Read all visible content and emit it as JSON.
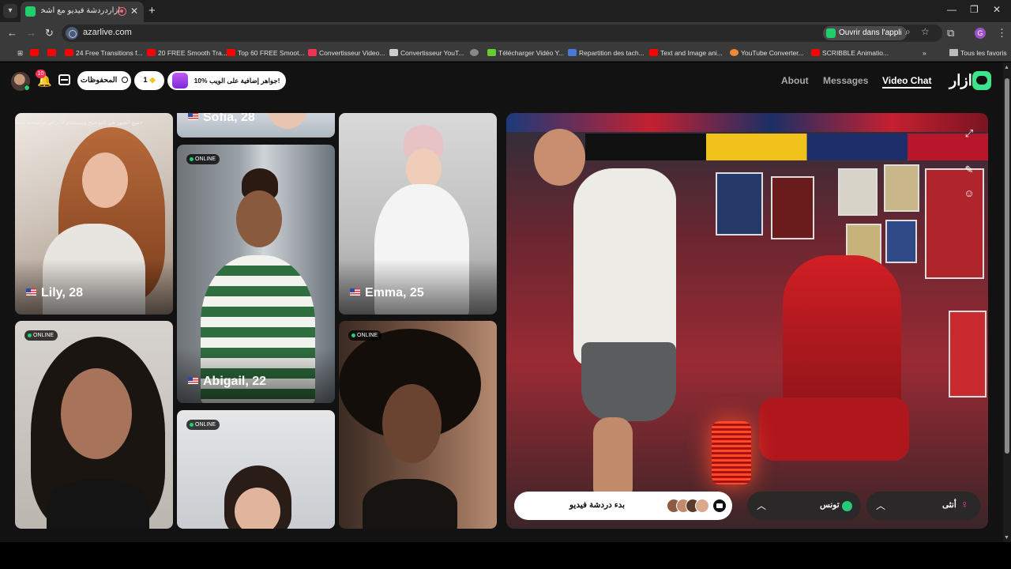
{
  "browser": {
    "tab_title": "أزاردردشة فيديو مع أشخاص",
    "url": "azarlive.com",
    "open_app_label": "Ouvrir dans l'appli",
    "profile_initial": "G",
    "bookmarks": [
      {
        "label": "",
        "icon": "youtube-icon"
      },
      {
        "label": "",
        "icon": "youtube-icon"
      },
      {
        "label": "24 Free Transitions f...",
        "icon": "youtube-icon"
      },
      {
        "label": "20 FREE Smooth Tra...",
        "icon": "youtube-icon"
      },
      {
        "label": "Top 60 FREE Smoot...",
        "icon": "youtube-icon"
      },
      {
        "label": "Convertisseur Video...",
        "icon": "z-icon"
      },
      {
        "label": "Convertisseur YouT...",
        "icon": "converter-icon"
      },
      {
        "label": "",
        "icon": "globe-icon"
      },
      {
        "label": "Télécharger Vidéo Y...",
        "icon": "download-icon"
      },
      {
        "label": "Repartition des tach...",
        "icon": "docs-icon"
      },
      {
        "label": "Text and Image ani...",
        "icon": "youtube-icon"
      },
      {
        "label": "YouTube Converter...",
        "icon": "converter-icon"
      },
      {
        "label": "SCRIBBLE Animatio...",
        "icon": "youtube-icon"
      }
    ],
    "all_bookmarks_label": "Tous les favoris"
  },
  "header": {
    "notification_count": "10",
    "saved_label": "المحفوظات",
    "gems_count": "1",
    "promo_label": "10% جواهر إضافية على الويب!",
    "nav": {
      "about": "About",
      "messages": "Messages",
      "video_chat": "Video Chat"
    },
    "brand": "ازار"
  },
  "cards": {
    "banner_text": "جميع الصور هي للتوضيح ويستخدم لأغراض توضيحية فقط",
    "sofia": "Sofia, 28",
    "lily": "Lily, 28",
    "abigail": "Abigail, 22",
    "emma": "Emma, 25",
    "online_label": "ONLINE"
  },
  "video_chat": {
    "start_label": "بدء دردشة فيديو",
    "country_label": "تونس",
    "gender_label": "أنثى"
  },
  "colors": {
    "accent_green": "#3ce58b",
    "online_green": "#1ed36b",
    "notification_red": "#ff2e55",
    "gender_pink": "#ff3f9a"
  }
}
